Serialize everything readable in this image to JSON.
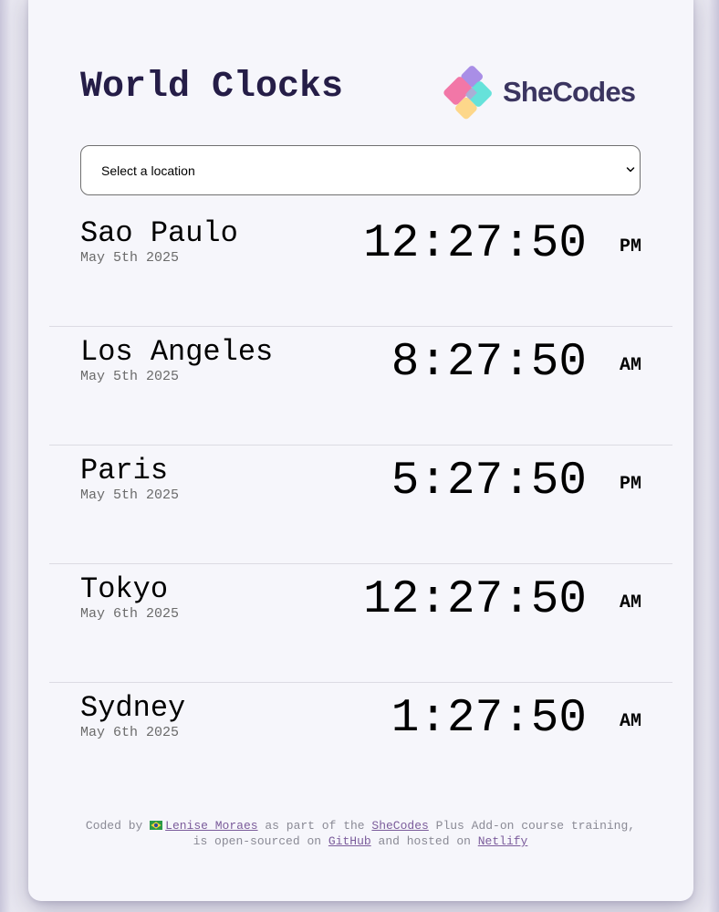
{
  "header": {
    "title": "World Clocks",
    "logo_text": "SheCodes"
  },
  "location_select": {
    "selected": "Select a location"
  },
  "cities": [
    {
      "name": "Sao Paulo",
      "date": "May 5th 2025",
      "time": "12:27:50",
      "ampm": "PM"
    },
    {
      "name": "Los Angeles",
      "date": "May 5th 2025",
      "time": "8:27:50",
      "ampm": "AM"
    },
    {
      "name": "Paris",
      "date": "May 5th 2025",
      "time": "5:27:50",
      "ampm": "PM"
    },
    {
      "name": "Tokyo",
      "date": "May 6th 2025",
      "time": "12:27:50",
      "ampm": "AM"
    },
    {
      "name": "Sydney",
      "date": "May 6th 2025",
      "time": "1:27:50",
      "ampm": "AM"
    }
  ],
  "footer": {
    "text_coded_by": "Coded by",
    "author_link": "Lenise Moraes",
    "author_flag_icon": "brazil-flag-icon",
    "text_part_of": "as part of the",
    "shecodes_link": "SheCodes",
    "text_course": "Plus Add-on course training, is open-sourced on",
    "github_link": "GitHub",
    "text_hosted": "and hosted on",
    "netlify_link": "Netlify"
  },
  "colors": {
    "title": "#251d47",
    "card_background": "#f6f6fb",
    "link": "#7b5c9b",
    "logo_purple": "#a98ee6",
    "logo_pink": "#f277a7",
    "logo_teal": "#5ee0d8",
    "logo_yellow": "#fdd78a"
  }
}
